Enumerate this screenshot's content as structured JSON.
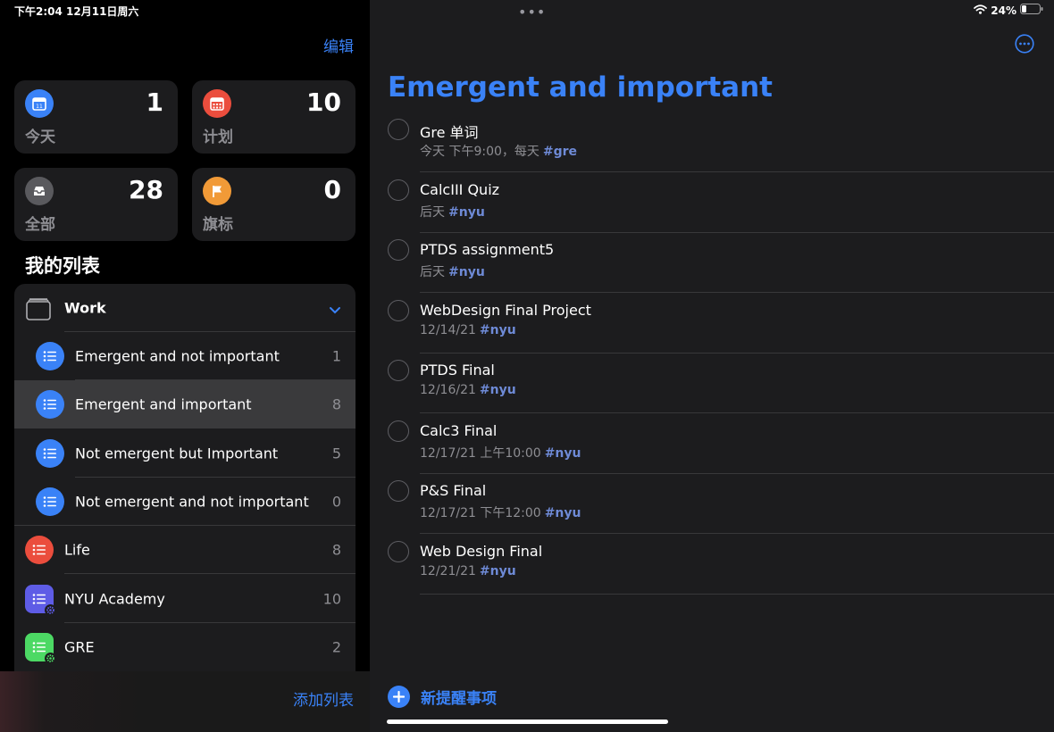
{
  "status_bar": {
    "time_date": "下午2:04   12月11日周六",
    "battery": "24%",
    "multitask_dots": "•••"
  },
  "sidebar": {
    "edit_label": "编辑",
    "smart_lists": [
      {
        "label": "今天",
        "count": "1",
        "icon": "calendar-today-icon",
        "color": "#3a82f7"
      },
      {
        "label": "计划",
        "count": "10",
        "icon": "calendar-scheduled-icon",
        "color": "#eb4d3d"
      },
      {
        "label": "全部",
        "count": "28",
        "icon": "inbox-tray-icon",
        "color": "#5a5a5e"
      },
      {
        "label": "旗标",
        "count": "0",
        "icon": "flag-icon",
        "color": "#f19a37"
      }
    ],
    "my_lists_title": "我的列表",
    "group": {
      "label": "Work",
      "expanded": true
    },
    "group_items": [
      {
        "label": "Emergent and not important",
        "count": "1"
      },
      {
        "label": "Emergent and important",
        "count": "8",
        "selected": true
      },
      {
        "label": "Not emergent but Important",
        "count": "5"
      },
      {
        "label": "Not emergent and not important",
        "count": "0"
      }
    ],
    "lists": [
      {
        "label": "Life",
        "count": "8",
        "color": "#eb4d3d",
        "shared": false
      },
      {
        "label": "NYU Academy",
        "count": "10",
        "color": "#5e5ce6",
        "shared": true
      },
      {
        "label": "GRE",
        "count": "2",
        "color": "#4cd964",
        "shared": true
      }
    ],
    "add_list_label": "添加列表"
  },
  "main": {
    "title": "Emergent and important",
    "tasks": [
      {
        "name": "Gre 单词",
        "meta": "今天 下午9:00，每天",
        "tag": "#gre"
      },
      {
        "name": "CalcIII Quiz",
        "meta": "后天",
        "tag": "#nyu"
      },
      {
        "name": "PTDS assignment5",
        "meta": "后天",
        "tag": "#nyu"
      },
      {
        "name": "WebDesign Final Project",
        "meta": "12/14/21",
        "tag": "#nyu"
      },
      {
        "name": "PTDS Final",
        "meta": "12/16/21",
        "tag": "#nyu"
      },
      {
        "name": "Calc3 Final",
        "meta": "12/17/21 上午10:00",
        "tag": "#nyu"
      },
      {
        "name": "P&S Final",
        "meta": "12/17/21 下午12:00",
        "tag": "#nyu"
      },
      {
        "name": "Web Design Final",
        "meta": "12/21/21",
        "tag": "#nyu"
      }
    ],
    "new_reminder_label": "新提醒事项"
  },
  "colors": {
    "accent": "#3a82f7",
    "tag": "#6e8ad6",
    "list_icon_blue": "#3a82f7"
  }
}
